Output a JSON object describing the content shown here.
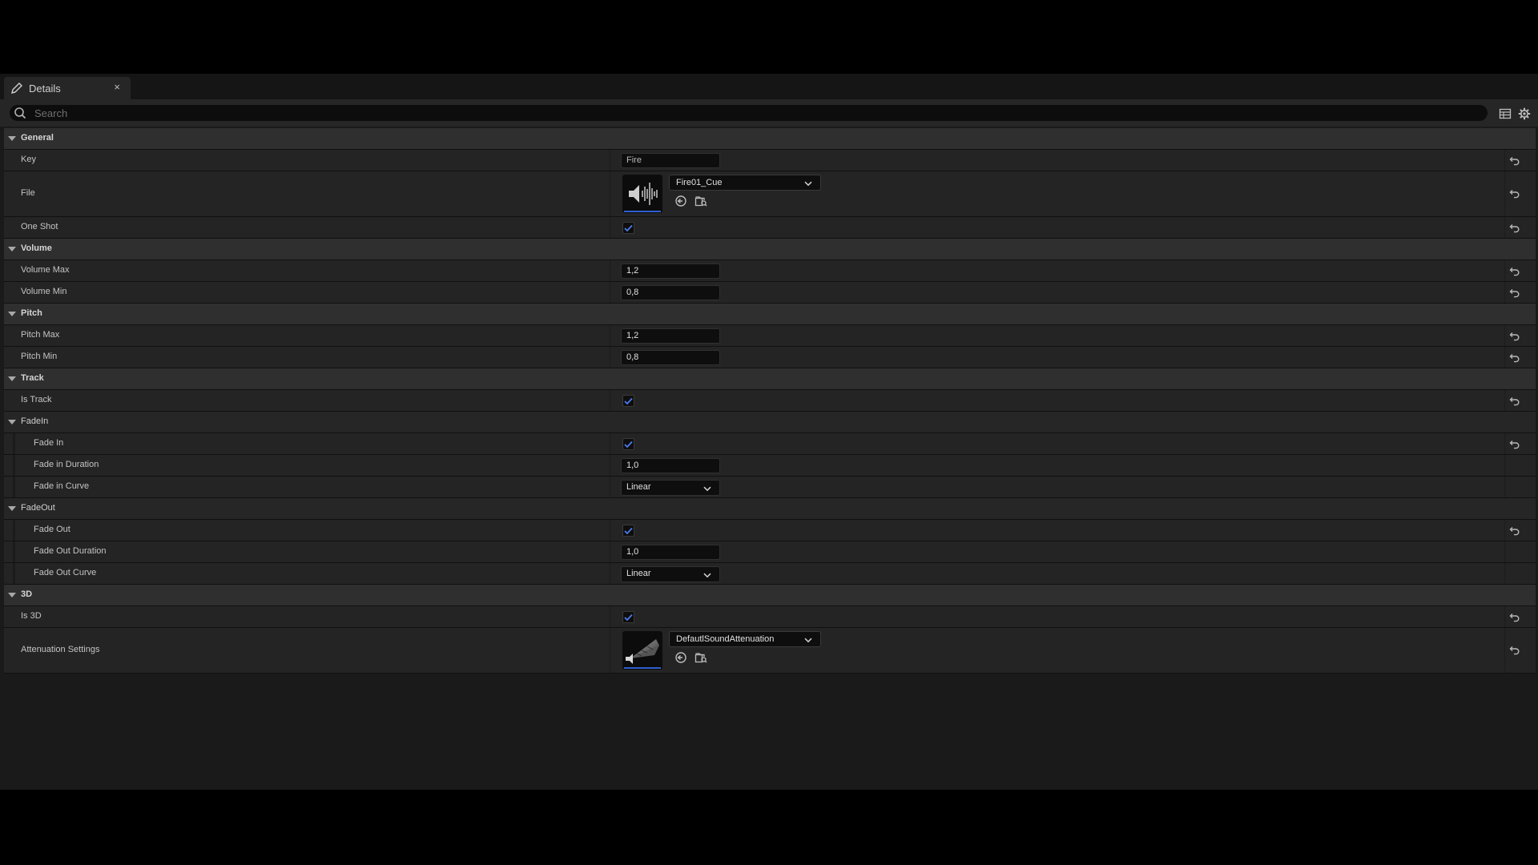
{
  "tab": {
    "title": "Details",
    "close": "×"
  },
  "search": {
    "placeholder": "Search"
  },
  "rows": [
    {
      "kind": "category",
      "label": "General"
    },
    {
      "kind": "prop",
      "label": "Key",
      "widget": "text",
      "value": "Fire",
      "reset": true
    },
    {
      "kind": "prop",
      "label": "File",
      "widget": "asset",
      "value": "Fire01_Cue",
      "thumb": "sound-cue",
      "reset": true
    },
    {
      "kind": "prop",
      "label": "One Shot",
      "widget": "checkbox",
      "checked": true,
      "reset": true
    },
    {
      "kind": "category",
      "label": "Volume"
    },
    {
      "kind": "prop",
      "label": "Volume Max",
      "widget": "number",
      "value": "1,2",
      "reset": true
    },
    {
      "kind": "prop",
      "label": "Volume Min",
      "widget": "number",
      "value": "0,8",
      "reset": true
    },
    {
      "kind": "category",
      "label": "Pitch"
    },
    {
      "kind": "prop",
      "label": "Pitch Max",
      "widget": "number",
      "value": "1,2",
      "reset": true
    },
    {
      "kind": "prop",
      "label": "Pitch Min",
      "widget": "number",
      "value": "0,8",
      "reset": true
    },
    {
      "kind": "category",
      "label": "Track"
    },
    {
      "kind": "prop",
      "label": "Is Track",
      "widget": "checkbox",
      "checked": true,
      "reset": true
    },
    {
      "kind": "subcategory",
      "label": "FadeIn"
    },
    {
      "kind": "prop",
      "label": "Fade In",
      "widget": "checkbox",
      "checked": true,
      "reset": true,
      "indent": true
    },
    {
      "kind": "prop",
      "label": "Fade in Duration",
      "widget": "number",
      "value": "1,0",
      "reset": false,
      "indent": true
    },
    {
      "kind": "prop",
      "label": "Fade in Curve",
      "widget": "combo",
      "value": "Linear",
      "reset": false,
      "indent": true
    },
    {
      "kind": "subcategory",
      "label": "FadeOut"
    },
    {
      "kind": "prop",
      "label": "Fade Out",
      "widget": "checkbox",
      "checked": true,
      "reset": true,
      "indent": true
    },
    {
      "kind": "prop",
      "label": "Fade Out Duration",
      "widget": "number",
      "value": "1,0",
      "reset": false,
      "indent": true
    },
    {
      "kind": "prop",
      "label": "Fade Out Curve",
      "widget": "combo",
      "value": "Linear",
      "reset": false,
      "indent": true
    },
    {
      "kind": "category",
      "label": "3D"
    },
    {
      "kind": "prop",
      "label": "Is 3D",
      "widget": "checkbox",
      "checked": true,
      "reset": true
    },
    {
      "kind": "prop",
      "label": "Attenuation Settings",
      "widget": "asset",
      "value": "DefautlSoundAttenuation",
      "thumb": "attenuation",
      "reset": true
    }
  ],
  "colors": {
    "accent": "#2f5fd0",
    "check": "#4b7cf0",
    "background": "#1a1a1a",
    "category": "#2f2f2f",
    "row": "#242424"
  },
  "icons": {
    "tab": "details-pencil-icon",
    "search": "search-icon",
    "table_view": "table-view-icon",
    "settings": "gear-icon",
    "reset": "reset-to-default-icon",
    "use_selected": "use-selected-asset-icon",
    "browse": "browse-to-asset-icon"
  }
}
